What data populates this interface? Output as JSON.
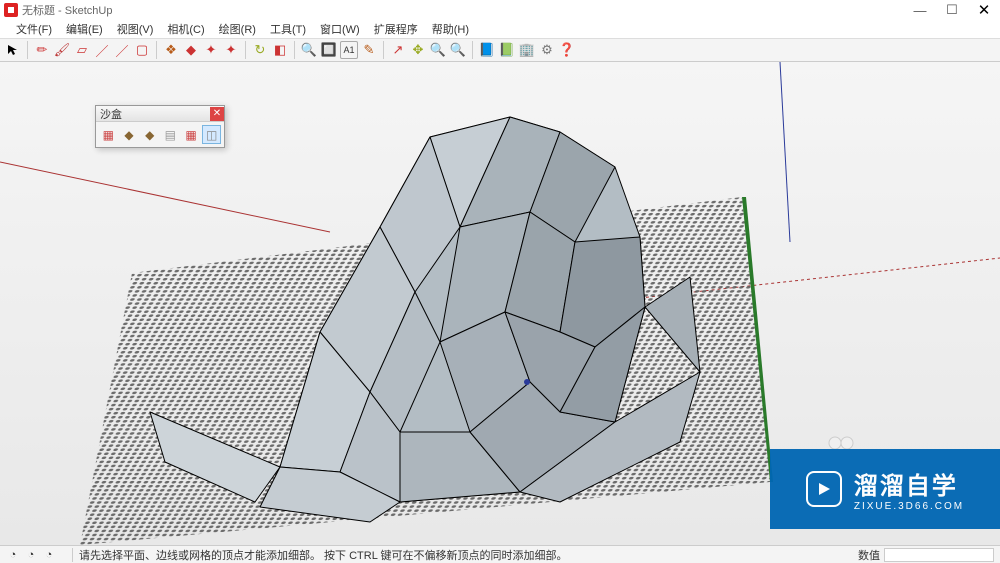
{
  "title": "无标题 - SketchUp",
  "menu": [
    "文件(F)",
    "编辑(E)",
    "视图(V)",
    "相机(C)",
    "绘图(R)",
    "工具(T)",
    "窗口(W)",
    "扩展程序",
    "帮助(H)"
  ],
  "toolbar": {
    "cursor": "▲",
    "groups": [
      [
        "✏",
        "🖌",
        "◫",
        "/",
        "/",
        "◫"
      ],
      [
        "🔷",
        "♦",
        "♦",
        "♦"
      ],
      [
        "↻",
        "◧"
      ],
      [
        "🔍",
        "🔲",
        "A",
        "✎"
      ],
      [
        "↗",
        "↔",
        "🔍",
        "🔍"
      ],
      [
        "📘",
        "📗",
        "🍊",
        "⚙",
        "?"
      ]
    ]
  },
  "panel": {
    "title": "沙盒",
    "tools": [
      "▦",
      "♦",
      "♦",
      "▤",
      "▦",
      "◫"
    ]
  },
  "status": {
    "icons": [
      "◔",
      "◔",
      "◔"
    ],
    "help": "请先选择平面、边线或网格的顶点才能添加细部。  按下 CTRL 键可在不偏移新顶点的同时添加细部。",
    "right_label": "数值"
  },
  "watermark": {
    "big": "溜溜自学",
    "small": "ZIXUE.3D66.COM"
  },
  "colors": {
    "red_axis": "#a33",
    "green_axis": "#2a7a2a",
    "blue_axis": "#2a3a9a",
    "mesh": "#9aa2a8",
    "brand": "#0066b3"
  }
}
